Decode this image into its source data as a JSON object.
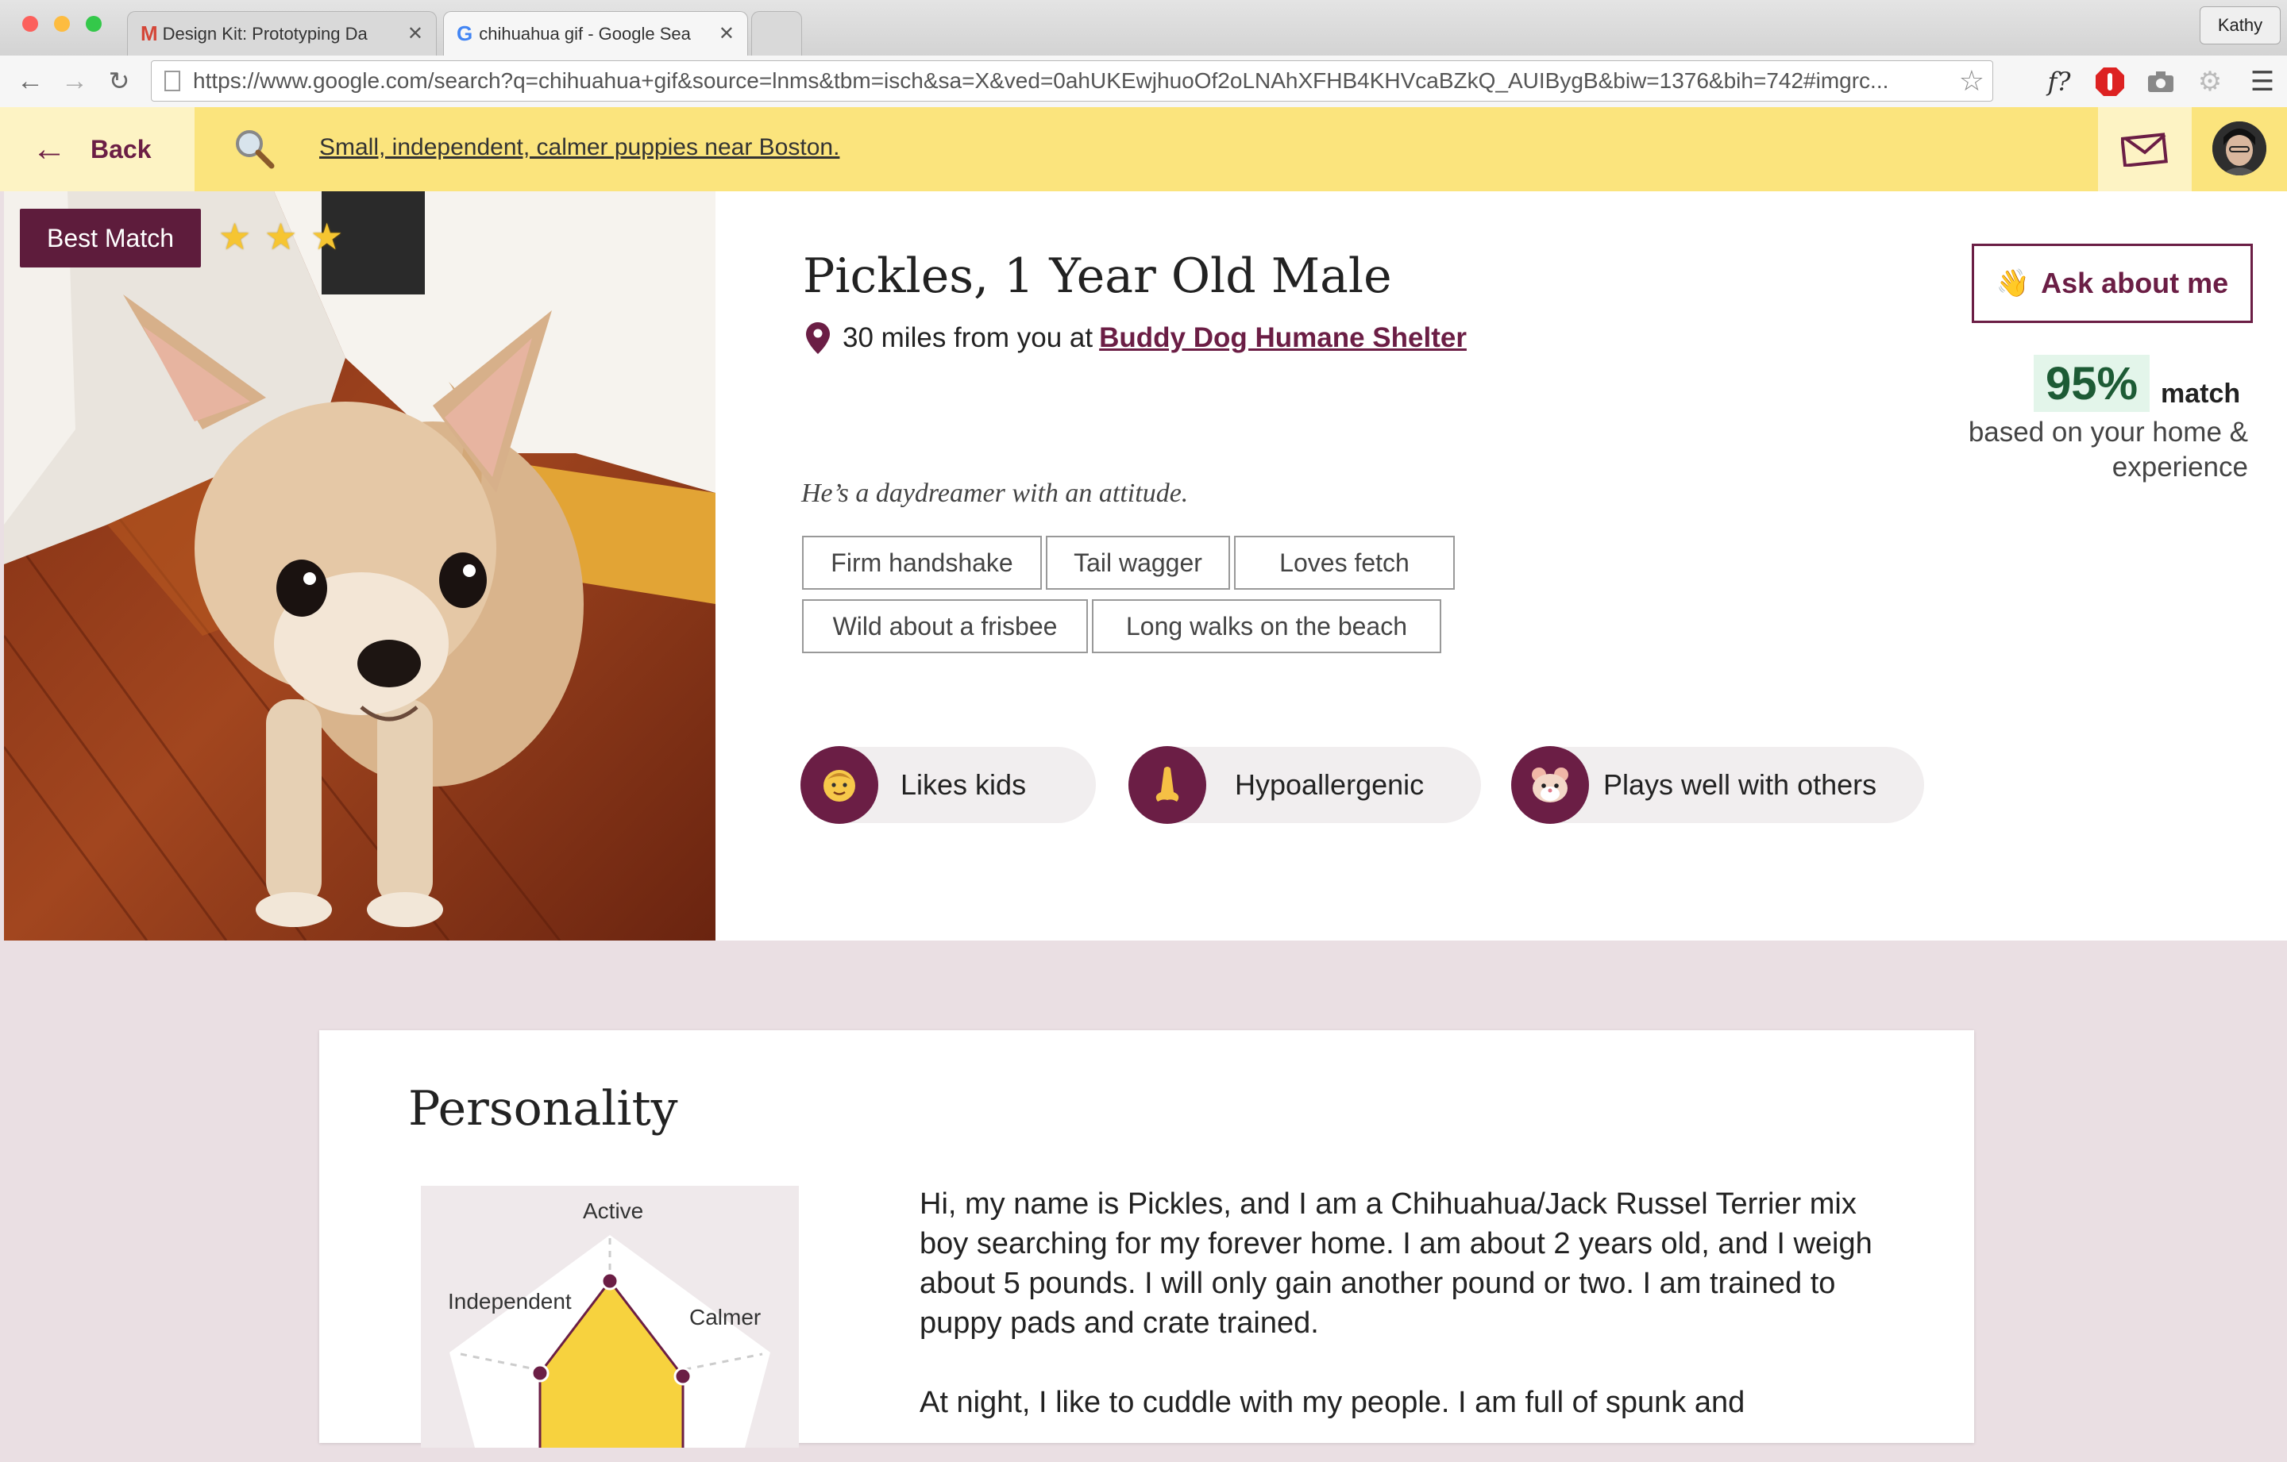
{
  "browser": {
    "tabs": [
      {
        "title": "Design Kit: Prototyping Da",
        "icon": "gmail-icon"
      },
      {
        "title": "chihuahua gif - Google Sea",
        "icon": "google-icon"
      }
    ],
    "profile_name": "Kathy",
    "url": "https://www.google.com/search?q=chihuahua+gif&source=lnms&tbm=isch&sa=X&ved=0ahUKEwjhuoOf2oLNAhXFHB4KHVcaBZkQ_AUIBygB&biw=1376&bih=742#imgrc..."
  },
  "header": {
    "back_label": "Back",
    "search_text": "Small, independent, calmer puppies near Boston."
  },
  "profile": {
    "badge": "Best Match",
    "stars": 3,
    "name": "Pickles, 1 Year Old Male",
    "distance": "30 miles from you at",
    "shelter": "Buddy Dog Humane Shelter",
    "tagline": "He’s a daydreamer with an attitude.",
    "tags": [
      "Firm handshake",
      "Tail wagger",
      "Loves fetch",
      "Wild about a frisbee",
      "Long walks on the beach"
    ],
    "traits": [
      {
        "label": "Likes kids",
        "icon": "baby-face-icon"
      },
      {
        "label": "Hypoallergenic",
        "icon": "nose-icon"
      },
      {
        "label": "Plays well with others",
        "icon": "hamster-icon"
      }
    ],
    "ask_label": "Ask about me",
    "ask_icon": "👋",
    "match_percent": "95%",
    "match_label": "match",
    "match_basis": "based on your home & experience"
  },
  "personality": {
    "title": "Personality",
    "radar_labels": {
      "top": "Active",
      "left": "Independent",
      "right": "Calmer"
    },
    "bio": [
      "Hi, my name is Pickles, and I am a Chihuahua/Jack Russel Terrier mix boy searching for my forever home. I am about 2 years old, and I weigh about 5 pounds. I will only gain another pound or two. I am trained to puppy pads and crate trained.",
      "At night, I like to cuddle with my people. I am full of spunk and"
    ]
  },
  "colors": {
    "brand": "#6b1e45",
    "header": "#fbe47d",
    "header_light": "#fdf3c4",
    "match_bg": "#e3f5ea",
    "page_bg": "#eadfe3"
  }
}
